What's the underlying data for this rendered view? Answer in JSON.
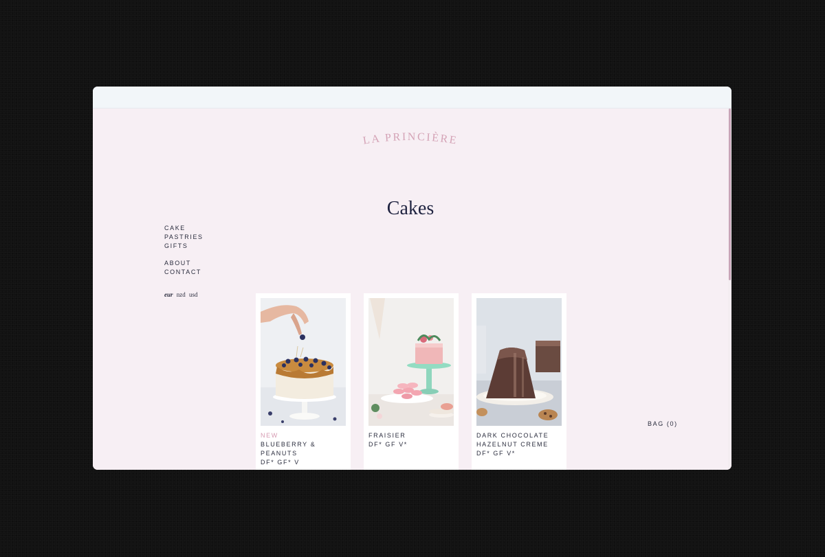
{
  "brand": {
    "logo_text": "LA PRINCIÈRE",
    "logo_color": "#d4a3b6"
  },
  "page": {
    "title": "Cakes"
  },
  "nav": {
    "shop": [
      {
        "label": "CAKE"
      },
      {
        "label": "PASTRIES"
      },
      {
        "label": "GIFTS"
      }
    ],
    "info": [
      {
        "label": "ABOUT"
      },
      {
        "label": "CONTACT"
      }
    ]
  },
  "currency": {
    "options": [
      "eur",
      "nzd",
      "usd"
    ],
    "selected": "eur"
  },
  "products": [
    {
      "badge": "NEW",
      "name_lines": [
        "BLUEBERRY &",
        "PEANUTS"
      ],
      "diet": "DF* GF* V",
      "image": "blueberry-cake-photo"
    },
    {
      "badge": "",
      "name_lines": [
        "FRAISIER"
      ],
      "diet": "DF* GF V*",
      "image": "fraisier-cake-photo"
    },
    {
      "badge": "",
      "name_lines": [
        "DARK CHOCOLATE",
        "HAZELNUT CREME"
      ],
      "diet": "DF* GF V*",
      "image": "chocolate-cake-photo"
    }
  ],
  "bag": {
    "label": "BAG (0)"
  },
  "colors": {
    "page_background": "#f7eff4",
    "accent_pink": "#d69bb2",
    "text_dark": "#2a2c3d",
    "title_navy": "#1f2340"
  }
}
